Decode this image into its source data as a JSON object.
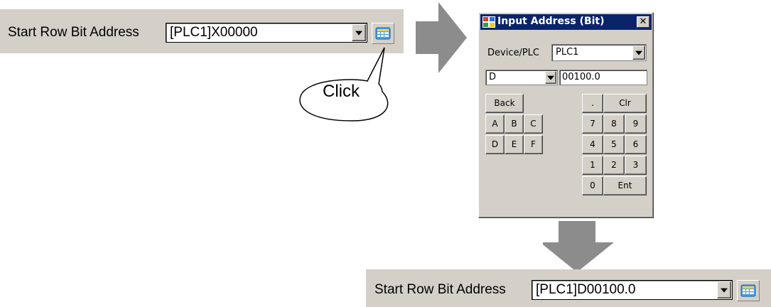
{
  "before": {
    "label": "Start Row Bit Address",
    "value": "[PLC1]X00000"
  },
  "callout": {
    "text": "Click"
  },
  "dialog": {
    "title": "Input Address (Bit)",
    "close_glyph": "✕",
    "device_label": "Device/PLC",
    "device_value": "PLC1",
    "type_value": "D",
    "address_value": "00100.0",
    "keys": {
      "back": "Back",
      "dot": ".",
      "clr": "Clr",
      "a": "A",
      "b": "B",
      "c": "C",
      "d": "D",
      "e": "E",
      "f": "F",
      "n7": "7",
      "n8": "8",
      "n9": "9",
      "n4": "4",
      "n5": "5",
      "n6": "6",
      "n1": "1",
      "n2": "2",
      "n3": "3",
      "n0": "0",
      "ent": "Ent"
    }
  },
  "after": {
    "label": "Start Row Bit Address",
    "value": "[PLC1]D00100.0"
  },
  "icons": {
    "address_keypad": "keypad-icon",
    "dropdown": "dropdown-arrow-icon",
    "window": "window-icon",
    "flow_right": "arrow-right-icon",
    "flow_down": "arrow-down-icon"
  },
  "colors": {
    "panel_gray": "#d4d0c8",
    "title_blue": "#0a246a",
    "arrow_gray": "#8c8c8c"
  }
}
